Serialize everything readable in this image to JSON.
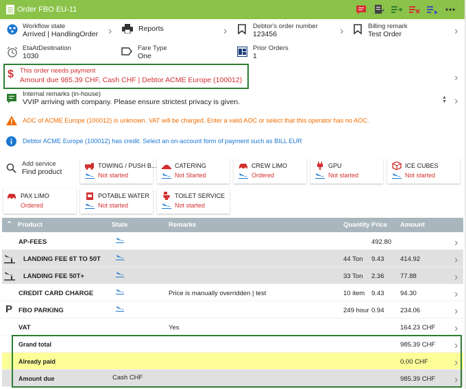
{
  "header": {
    "title": "Order FBO EU-11"
  },
  "info": {
    "workflow_label": "Workflow state",
    "workflow_value": "Arrived | HandlingOrder",
    "reports_label": "Reports",
    "debtor_order_label": "Debtor's order number",
    "debtor_order_value": "123456",
    "billing_label": "Billing remark",
    "billing_value": "Test Order",
    "eta_label": "EtaAtDestination",
    "eta_value": "1030",
    "fare_label": "Fare Type",
    "fare_value": "One",
    "prior_label": "Prior Orders",
    "prior_value": "1"
  },
  "payment": {
    "title": "This order needs payment",
    "detail": "Amount due 985.39 CHF, Cash CHF | Debtor ACME Europe (100012)"
  },
  "remarks": {
    "label": "Internal remarks (in-house)",
    "text": "VVIP arriving with company. Please ensure strictest privacy is given."
  },
  "alerts": {
    "aoc": "AOC of ACME Europe (100012) is unknown. VAT will be charged. Enter a valid AOC or select that this operator has no AOC.",
    "credit": "Debtor ACME Europe (100012) has credit. Select an on-account form of payment such as BILL EUR"
  },
  "add_service": {
    "label": "Add service",
    "value": "Find product"
  },
  "services": [
    {
      "name": "TOWING / PUSH B...",
      "status": "Not started"
    },
    {
      "name": "CATERING",
      "status": "Not Started"
    },
    {
      "name": "CREW LIMO",
      "status": "Ordered"
    },
    {
      "name": "GPU",
      "status": "Not started"
    },
    {
      "name": "ICE CUBES",
      "status": "Not started"
    },
    {
      "name": "PAX LIMO",
      "status": "Ordered"
    },
    {
      "name": "POTABLE WATER",
      "status": "Not started"
    },
    {
      "name": "TOILET SERVICE",
      "status": "Not started"
    }
  ],
  "table": {
    "headers": {
      "product": "Product",
      "state": "State",
      "remarks": "Remarks",
      "quantity": "Quantity",
      "price": "Price",
      "amount": "Amount"
    },
    "rows": [
      {
        "product": "AP-FEES",
        "remarks": "",
        "quantity": "",
        "price": "492.80",
        "amount": ""
      },
      {
        "product": "LANDING FEE 6T TO 50T",
        "remarks": "",
        "quantity": "44 Ton",
        "price": "9.43",
        "amount": "414.92"
      },
      {
        "product": "LANDING FEE 50T+",
        "remarks": "",
        "quantity": "33 Ton",
        "price": "2.36",
        "amount": "77.88"
      },
      {
        "product": "CREDIT CARD CHARGE",
        "remarks": "Price is manually overridden | test",
        "quantity": "10 item",
        "price": "9.43",
        "amount": "94.30"
      },
      {
        "product": "FBO PARKING",
        "remarks": "",
        "quantity": "249 hour",
        "price": "0.94",
        "amount": "234.06"
      },
      {
        "product": "VAT",
        "remarks": "Yes",
        "quantity": "",
        "price": "",
        "amount": "164.23 CHF"
      }
    ],
    "totals": [
      {
        "label": "Grand total",
        "extra": "",
        "amount": "985.39 CHF"
      },
      {
        "label": "Already paid",
        "extra": "",
        "amount": "0.00 CHF"
      },
      {
        "label": "Amount due",
        "extra": "Cash CHF",
        "amount": "985.39 CHF"
      }
    ]
  },
  "colors": {
    "header": "#8bc34a",
    "alert_red": "#d32f2f",
    "alert_orange": "#ef6c00",
    "info_blue": "#1976d2",
    "highlight_green": "#2e7d32"
  }
}
